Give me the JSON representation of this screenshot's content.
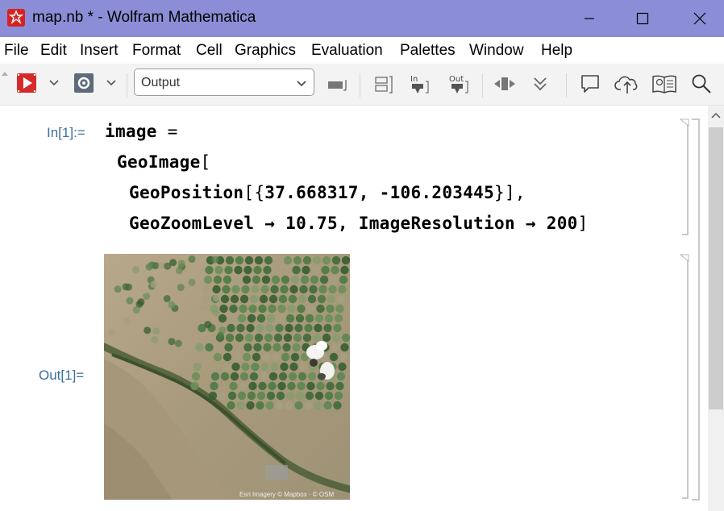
{
  "window": {
    "title": "map.nb * - Wolfram Mathematica",
    "app_icon": "mathematica-icon",
    "controls": [
      "minimize-icon",
      "maximize-icon",
      "close-icon"
    ]
  },
  "menu": [
    "File",
    "Edit",
    "Insert",
    "Format",
    "Cell",
    "Graphics",
    "Evaluation",
    "Palettes",
    "Window",
    "Help"
  ],
  "toolbar": {
    "style_select_value": "Output",
    "icons": [
      "evaluate-icon",
      "abort-icon",
      "cell-style-icon",
      "cell-group-icon",
      "input-cell-icon",
      "output-cell-icon",
      "expand-icon",
      "collapse-icon",
      "comment-icon",
      "cloud-publish-icon",
      "documentation-icon",
      "search-icon"
    ]
  },
  "notebook": {
    "input_label": "In[1]:=",
    "output_label": "Out[1]=",
    "code": {
      "line1_symbol": "image",
      "line1_op": " =",
      "line2_head": "GeoImage",
      "line2_bracket": "[",
      "line3_head": "GeoPosition",
      "line3_open": "[{",
      "line3_lat": "37.668317",
      "line3_sep": ", ",
      "line3_lon": "-106.203445",
      "line3_close": "}],",
      "line4_opt1": "GeoZoomLevel",
      "line4_arrow1": " → ",
      "line4_val1": "10.75",
      "line4_sep": ", ",
      "line4_opt2": "ImageResolution",
      "line4_arrow2": " → ",
      "line4_val2": "200",
      "line4_close": "]"
    },
    "map_credit": "Esri Imagery © Mapbox · © OSM",
    "colors": {
      "cell_label": "#3b6f9e",
      "title_bar": "#8b8ed6",
      "bracket": "#c9c9c9"
    }
  }
}
